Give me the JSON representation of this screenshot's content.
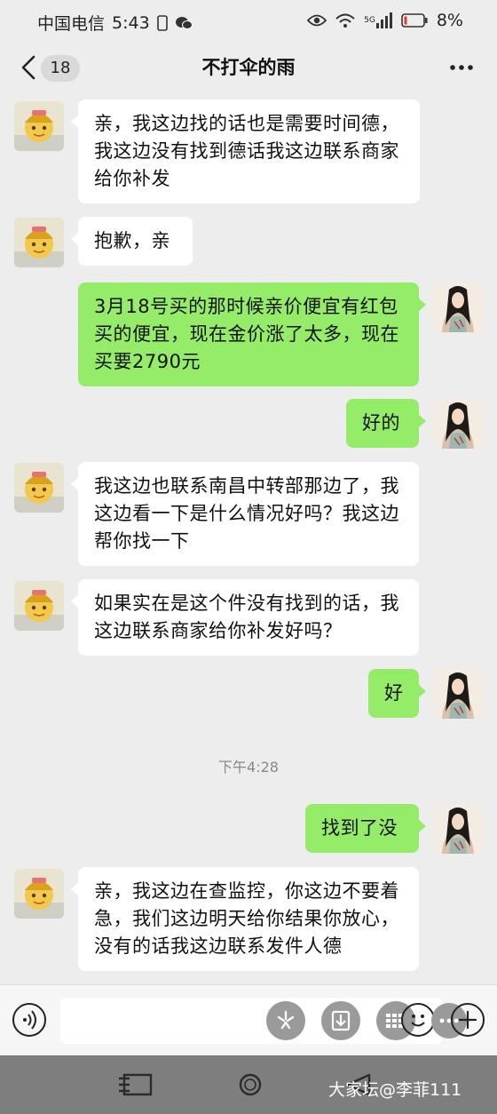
{
  "status_bar": {
    "carrier": "中国电信",
    "time": "5:43",
    "network": "5G",
    "battery_percent": "8%"
  },
  "header": {
    "back_count": "18",
    "title": "不打伞的雨"
  },
  "messages": [
    {
      "side": "recv",
      "text": "亲，我这边找的话也是需要时间德，我这边没有找到德话我这边联系商家给你补发"
    },
    {
      "side": "recv",
      "text": "抱歉，亲"
    },
    {
      "side": "sent",
      "text": "3月18号买的那时候亲价便宜有红包买的便宜，现在金价涨了太多，现在买要2790元"
    },
    {
      "side": "sent",
      "text": "好的"
    },
    {
      "side": "recv",
      "text": "我这边也联系南昌中转部那边了，我这边看一下是什么情况好吗？我这边帮你找一下"
    },
    {
      "side": "recv",
      "text": "如果实在是这个件没有找到的话，我这边联系商家给你补发好吗？"
    },
    {
      "side": "sent",
      "text": "好"
    },
    {
      "side": "sent",
      "text": "找到了没"
    },
    {
      "side": "recv",
      "text": "亲，我这边在查监控，你这边不要着急，我们这边明天给你结果你放心，没有的话我这边联系发件人德"
    }
  ],
  "timestamp": "下午4:28",
  "watermark": "大家坛@李菲111",
  "colors": {
    "background": "#ededed",
    "sent_bubble": "#95ec69",
    "recv_bubble": "#ffffff",
    "system_nav": "#7e7e7e"
  }
}
